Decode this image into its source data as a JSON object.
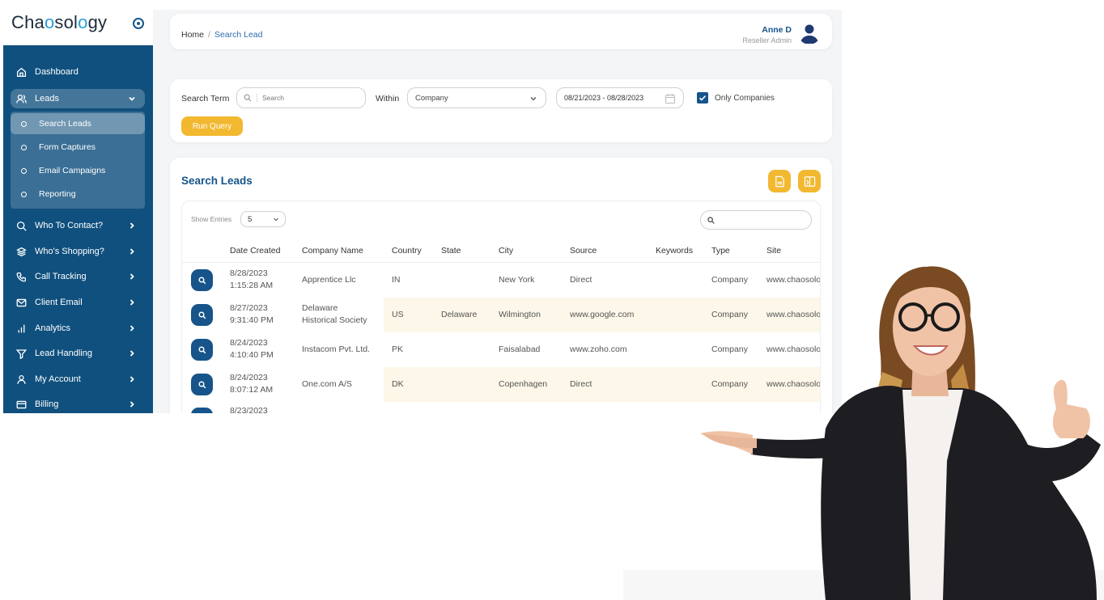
{
  "sidebar": {
    "logo_text": "Chaosology",
    "logo_parts": [
      "Cha",
      "o",
      "sol",
      "o",
      "gy"
    ],
    "items": [
      {
        "label": "Dashboard",
        "icon": "home-icon"
      },
      {
        "label": "Leads",
        "icon": "users-icon"
      },
      {
        "label": "Who To Contact?",
        "icon": "search-icon"
      },
      {
        "label": "Who's Shopping?",
        "icon": "layers-icon"
      },
      {
        "label": "Call Tracking",
        "icon": "phone-icon"
      },
      {
        "label": "Client Email",
        "icon": "mail-icon"
      },
      {
        "label": "Analytics",
        "icon": "bar-chart-icon"
      },
      {
        "label": "Lead Handling",
        "icon": "filter-icon"
      },
      {
        "label": "My Account",
        "icon": "user-icon"
      },
      {
        "label": "Billing",
        "icon": "billing-icon"
      }
    ],
    "leads_submenu": [
      "Search Leads",
      "Form Captures",
      "Email Campaigns",
      "Reporting"
    ]
  },
  "header": {
    "breadcrumb_home": "Home",
    "breadcrumb_sep": "/",
    "breadcrumb_current": "Search Lead",
    "user_name": "Anne D",
    "user_role": "Reseller Admin"
  },
  "filters": {
    "search_term_label": "Search Term",
    "search_placeholder": "Search",
    "within_label": "Within",
    "within_value": "Company",
    "date_range": "08/21/2023 - 08/28/2023",
    "only_companies_label": "Only Companies",
    "only_companies_checked": true,
    "run_query_label": "Run Query"
  },
  "table": {
    "title": "Search Leads",
    "show_entries_label": "Show Entries",
    "show_entries_value": "5",
    "columns": [
      "Date Created",
      "Company Name",
      "Country",
      "State",
      "City",
      "Source",
      "Keywords",
      "Type",
      "Site"
    ],
    "rows": [
      {
        "date": "8/28/2023",
        "time": "1:15:28 AM",
        "company": "Apprentice Llc",
        "company2": "",
        "country": "IN",
        "state": "",
        "city": "New York",
        "source": "Direct",
        "keywords": "",
        "type": "Company",
        "site": "www.chaosology.com"
      },
      {
        "date": "8/27/2023",
        "time": "9:31:40 PM",
        "company": "Delaware",
        "company2": "Historical Society",
        "country": "US",
        "state": "Delaware",
        "city": "Wilmington",
        "source": "www.google.com",
        "keywords": "",
        "type": "Company",
        "site": "www.chaosology.com"
      },
      {
        "date": "8/24/2023",
        "time": "4:10:40 PM",
        "company": "Instacom Pvt. Ltd.",
        "company2": "",
        "country": "PK",
        "state": "",
        "city": "Faisalabad",
        "source": "www.zoho.com",
        "keywords": "",
        "type": "Company",
        "site": "www.chaosology.com"
      },
      {
        "date": "8/24/2023",
        "time": "8:07:12 AM",
        "company": "One.com A/S",
        "company2": "",
        "country": "DK",
        "state": "",
        "city": "Copenhagen",
        "source": "Direct",
        "keywords": "",
        "type": "Company",
        "site": "www.chaosology.com"
      },
      {
        "date": "8/23/2023",
        "time": "",
        "company": "",
        "company2": "",
        "country": "",
        "state": "",
        "city": "",
        "source": "",
        "keywords": "",
        "type": "",
        "site": ""
      }
    ]
  },
  "colors": {
    "primary": "#10507e",
    "accent": "#f2b830",
    "row_highlight": "#fcf7e8"
  }
}
